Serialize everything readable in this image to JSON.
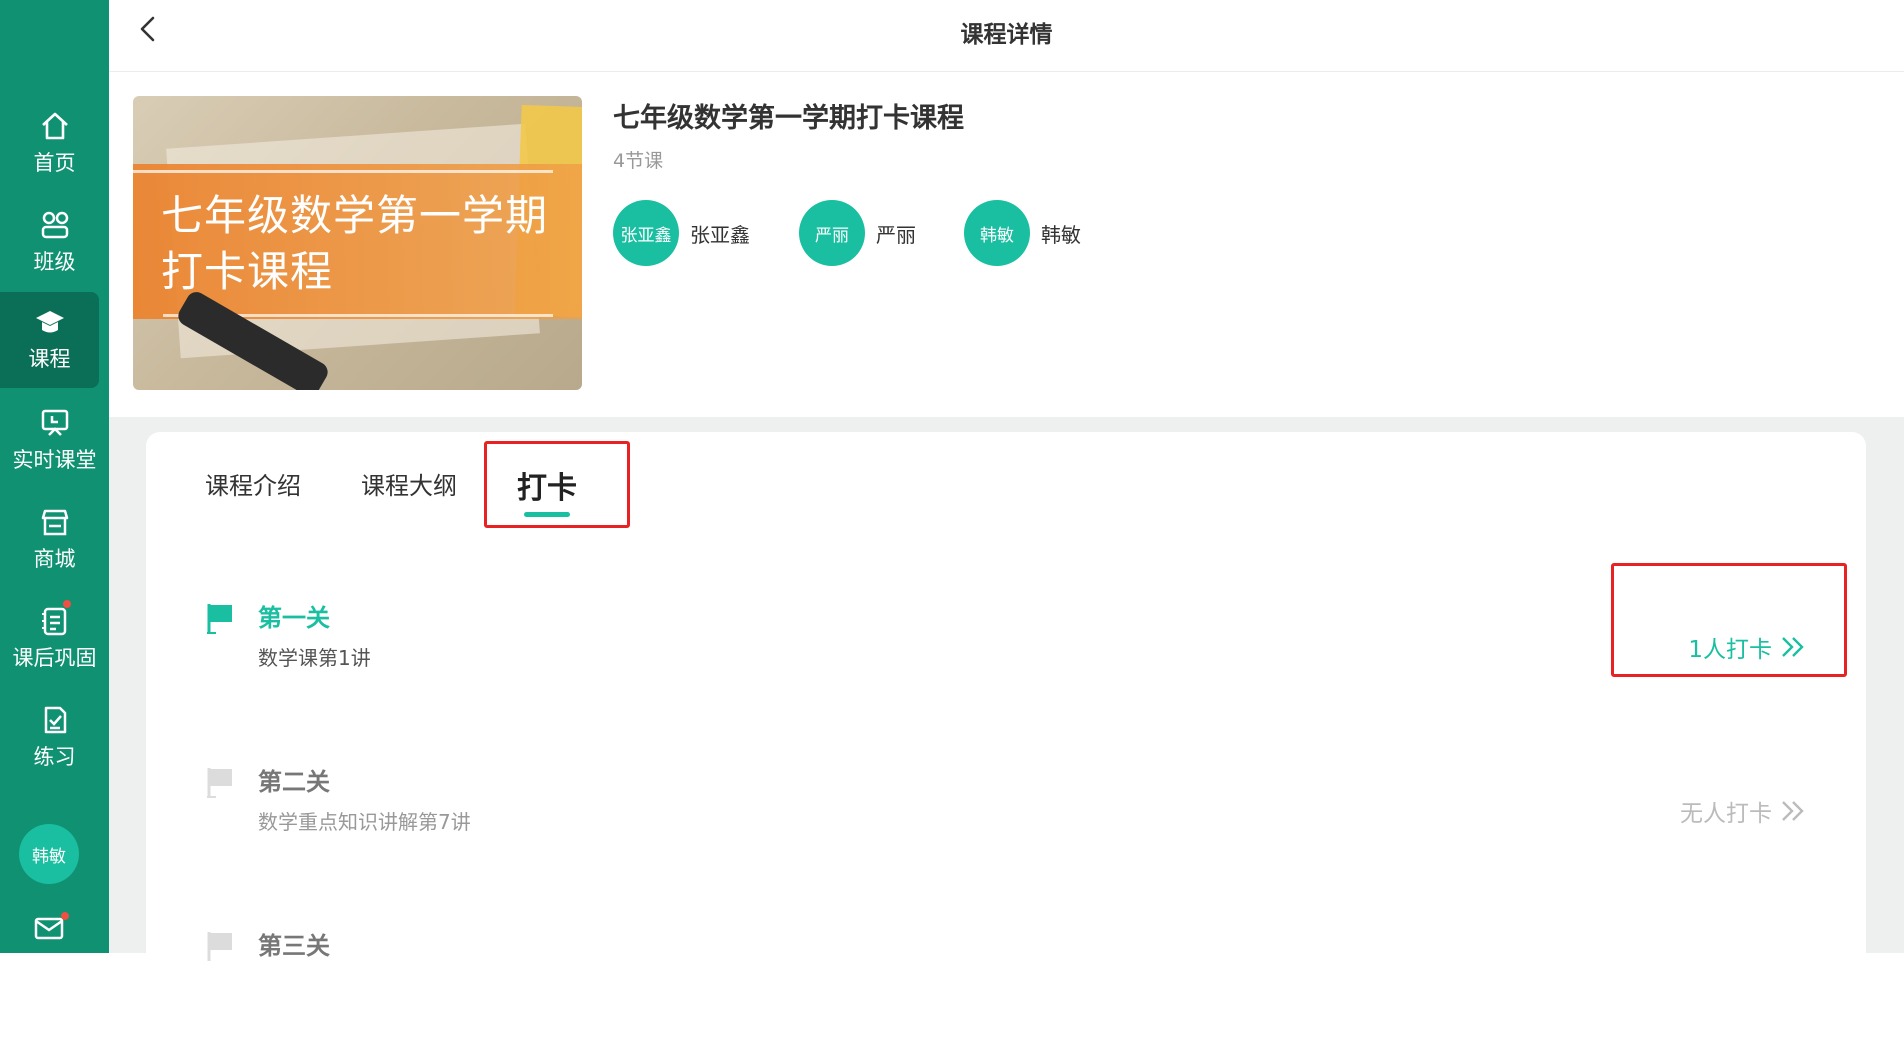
{
  "sidebar": {
    "items": [
      {
        "label": "首页",
        "icon": "home-icon"
      },
      {
        "label": "班级",
        "icon": "class-icon"
      },
      {
        "label": "课程",
        "icon": "graduation-cap-icon"
      },
      {
        "label": "实时课堂",
        "icon": "live-class-icon"
      },
      {
        "label": "商城",
        "icon": "store-icon"
      },
      {
        "label": "课后巩固",
        "icon": "homework-icon"
      },
      {
        "label": "练习",
        "icon": "practice-icon"
      }
    ],
    "active_index": 2,
    "user_avatar": "韩敏",
    "mail_icon": "mail-icon"
  },
  "header": {
    "title": "课程详情"
  },
  "course": {
    "cover_text": "七年级数学第一学期打卡课程",
    "title": "七年级数学第一学期打卡课程",
    "lesson_count": "4节课",
    "teachers": [
      {
        "avatar": "张亚鑫",
        "name": "张亚鑫"
      },
      {
        "avatar": "严丽",
        "name": "严丽"
      },
      {
        "avatar": "韩敏",
        "name": "韩敏"
      }
    ]
  },
  "tabs": [
    {
      "label": "课程介绍"
    },
    {
      "label": "课程大纲"
    },
    {
      "label": "打卡"
    }
  ],
  "active_tab": 2,
  "levels": [
    {
      "name": "第一关",
      "desc": "数学课第1讲",
      "checkin": "1人打卡",
      "active": true
    },
    {
      "name": "第二关",
      "desc": "数学重点知识讲解第7讲",
      "checkin": "无人打卡",
      "active": false
    },
    {
      "name": "第三关",
      "desc": "",
      "checkin": "",
      "active": false
    }
  ],
  "colors": {
    "primary": "#0f9172",
    "accent": "#19bfa0",
    "highlight": "#e82222"
  }
}
